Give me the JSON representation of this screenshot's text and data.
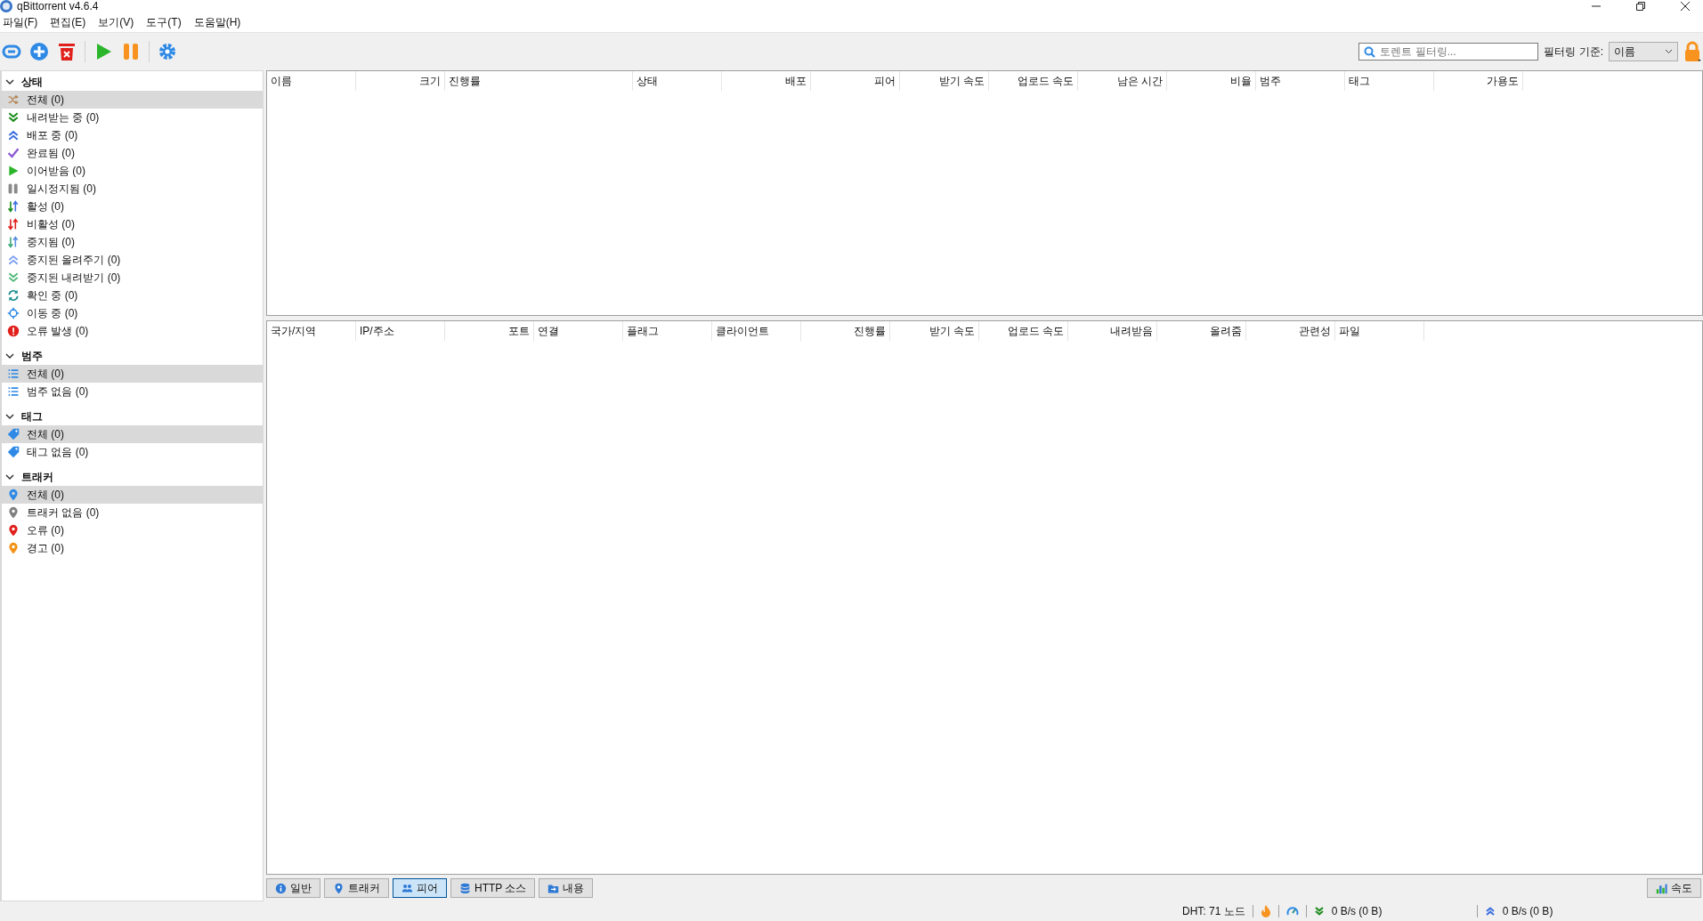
{
  "window": {
    "title": "qBittorrent v4.6.4"
  },
  "menu": [
    "파일(F)",
    "편집(E)",
    "보기(V)",
    "도구(T)",
    "도움말(H)"
  ],
  "toolbar": {
    "search": {
      "placeholder": "토렌트 필터링..."
    },
    "filter_label": "필터링 기준:",
    "filter_value": "이름"
  },
  "sidebar": [
    {
      "title": "상태",
      "expanded": true,
      "items": [
        {
          "label": "전체 (0)",
          "kind": "shuffle",
          "selected": true
        },
        {
          "label": "내려받는 중 (0)",
          "kind": "down",
          "selected": false
        },
        {
          "label": "배포 중 (0)",
          "kind": "up",
          "selected": false
        },
        {
          "label": "완료됨 (0)",
          "kind": "check",
          "selected": false
        },
        {
          "label": "이어받음 (0)",
          "kind": "play",
          "selected": false
        },
        {
          "label": "일시정지됨 (0)",
          "kind": "pause",
          "selected": false
        },
        {
          "label": "활성 (0)",
          "kind": "active",
          "selected": false
        },
        {
          "label": "비활성 (0)",
          "kind": "inactive",
          "selected": false
        },
        {
          "label": "중지됨 (0)",
          "kind": "stopped",
          "selected": false
        },
        {
          "label": "중지된 올려주기 (0)",
          "kind": "uplight",
          "selected": false
        },
        {
          "label": "중지된 내려받기 (0)",
          "kind": "downlight",
          "selected": false
        },
        {
          "label": "확인 중 (0)",
          "kind": "refresh",
          "selected": false
        },
        {
          "label": "이동 중 (0)",
          "kind": "crosshair",
          "selected": false
        },
        {
          "label": "오류 발생 (0)",
          "kind": "error",
          "selected": false
        }
      ]
    },
    {
      "title": "범주",
      "expanded": true,
      "items": [
        {
          "label": "전체 (0)",
          "kind": "list",
          "selected": true
        },
        {
          "label": "범주 없음 (0)",
          "kind": "list",
          "selected": false
        }
      ]
    },
    {
      "title": "태그",
      "expanded": true,
      "items": [
        {
          "label": "전체 (0)",
          "kind": "tag",
          "selected": true
        },
        {
          "label": "태그 없음 (0)",
          "kind": "tag",
          "selected": false
        }
      ]
    },
    {
      "title": "트래커",
      "expanded": true,
      "items": [
        {
          "label": "전체 (0)",
          "kind": "pin",
          "color": "#2f8ae6",
          "selected": true
        },
        {
          "label": "트래커 없음 (0)",
          "kind": "pin",
          "color": "#808080",
          "selected": false
        },
        {
          "label": "오류 (0)",
          "kind": "pin",
          "color": "#e0201c",
          "selected": false
        },
        {
          "label": "경고 (0)",
          "kind": "pin",
          "color": "#f29318",
          "selected": false
        }
      ]
    }
  ],
  "torrent_table": {
    "columns": [
      "이름",
      "크기",
      "진행률",
      "상태",
      "배포",
      "피어",
      "받기 속도",
      "업로드 속도",
      "남은 시간",
      "비율",
      "범주",
      "태그",
      "가용도"
    ]
  },
  "peer_table": {
    "columns": [
      "국가/지역",
      "IP/주소",
      "포트",
      "연결",
      "플래그",
      "클라이언트",
      "진행률",
      "받기 속도",
      "업로드 속도",
      "내려받음",
      "올려줌",
      "관련성",
      "파일"
    ]
  },
  "detail_tabs": [
    {
      "label": "일반",
      "kind": "info",
      "selected": false
    },
    {
      "label": "트래커",
      "kind": "pin",
      "selected": false
    },
    {
      "label": "피어",
      "kind": "people",
      "selected": true
    },
    {
      "label": "HTTP 소스",
      "kind": "db",
      "selected": false
    },
    {
      "label": "내용",
      "kind": "folder",
      "selected": false
    }
  ],
  "speed_button": "속도",
  "status_bar": {
    "dht": "DHT: 71 노드",
    "download": "0 B/s (0 B)",
    "upload": "0 B/s (0 B)"
  }
}
